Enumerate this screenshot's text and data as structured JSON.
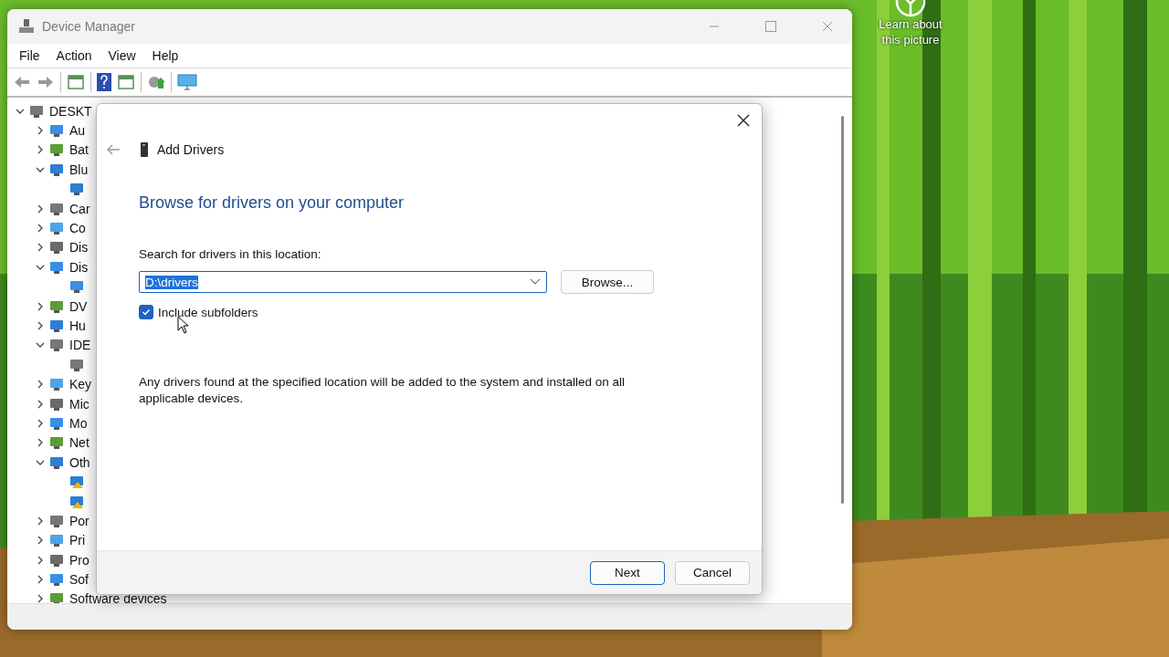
{
  "desktop": {
    "spotlight": "Learn about this picture"
  },
  "window": {
    "title": "Device Manager",
    "menu": [
      "File",
      "Action",
      "View",
      "Help"
    ]
  },
  "tree": {
    "root": {
      "label": "DESKT",
      "expanded": true
    },
    "items": [
      {
        "label": "Au",
        "expanded": false
      },
      {
        "label": "Bat",
        "expanded": false
      },
      {
        "label": "Blu",
        "expanded": true,
        "children": [
          {
            "warning": false
          }
        ]
      },
      {
        "label": "Car",
        "expanded": false
      },
      {
        "label": "Co",
        "expanded": false
      },
      {
        "label": "Dis",
        "expanded": false
      },
      {
        "label": "Dis",
        "expanded": true,
        "children": [
          {
            "warning": false
          }
        ]
      },
      {
        "label": "DV",
        "expanded": false
      },
      {
        "label": "Hu",
        "expanded": false
      },
      {
        "label": "IDE",
        "expanded": true,
        "children": [
          {
            "warning": false
          }
        ]
      },
      {
        "label": "Key",
        "expanded": false
      },
      {
        "label": "Mic",
        "expanded": false
      },
      {
        "label": "Mo",
        "expanded": false
      },
      {
        "label": "Net",
        "expanded": false
      },
      {
        "label": "Oth",
        "expanded": true,
        "children": [
          {
            "warning": true
          },
          {
            "warning": true
          }
        ]
      },
      {
        "label": "Por",
        "expanded": false
      },
      {
        "label": "Pri",
        "expanded": false
      },
      {
        "label": "Pro",
        "expanded": false
      },
      {
        "label": "Sof",
        "expanded": false
      },
      {
        "label": "Software devices",
        "expanded": false
      }
    ]
  },
  "dialog": {
    "title": "Add Drivers",
    "heading": "Browse for drivers on your computer",
    "location_label": "Search for drivers in this location:",
    "location": {
      "value": "D:\\drivers",
      "selected": true
    },
    "browse": "Browse...",
    "include_subfolders": {
      "label": "Include subfolders",
      "checked": true
    },
    "note": "Any drivers found at the specified location will be added to the system and installed on all applicable devices.",
    "buttons": [
      {
        "label": "Next",
        "primary": true
      },
      {
        "label": "Cancel",
        "primary": false
      }
    ]
  }
}
